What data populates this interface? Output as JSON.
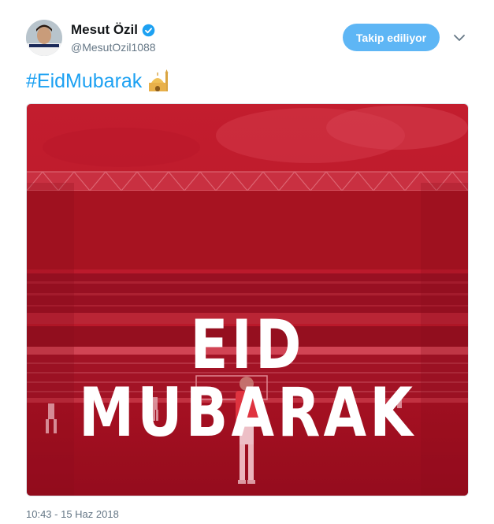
{
  "author": {
    "name": "Mesut Özil",
    "handle": "@MesutOzil1088",
    "verified": true
  },
  "follow_button": {
    "label": "Takip ediliyor"
  },
  "tweet": {
    "hashtag": "#EidMubarak",
    "emoji_icon": "mosque-icon"
  },
  "media": {
    "overlay_text": "EID MUBARAK",
    "tint_color": "#c8102e"
  },
  "timestamp": "10:43 - 15 Haz 2018",
  "colors": {
    "accent": "#1da1f2",
    "button": "#5eb6f5",
    "secondary_text": "#657786"
  }
}
